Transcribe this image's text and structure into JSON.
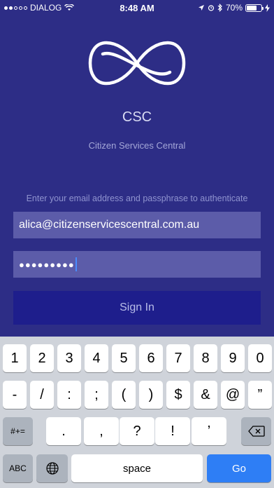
{
  "status_bar": {
    "carrier": "DIALOG",
    "time": "8:48 AM",
    "battery_percent": "70%",
    "battery_level": 0.7
  },
  "brand": {
    "name": "CSC",
    "subtitle": "Citizen Services Central"
  },
  "form": {
    "instructions": "Enter your email address and passphrase to authenticate",
    "email_value": "alica@citizenservicescentral.com.au",
    "password_mask": "●●●●●●●●●",
    "signin_label": "Sign In"
  },
  "keyboard": {
    "row1": [
      "1",
      "2",
      "3",
      "4",
      "5",
      "6",
      "7",
      "8",
      "9",
      "0"
    ],
    "row2": [
      "-",
      "/",
      ":",
      ";",
      "(",
      ")",
      "$",
      "&",
      "@",
      "”"
    ],
    "row3": [
      ".",
      ",",
      "?",
      "!",
      "’"
    ],
    "mode_key": "#+=",
    "abc_key": "ABC",
    "space_key": "space",
    "go_key": "Go"
  },
  "colors": {
    "background": "#2d2d86",
    "field": "#5c5ca9",
    "button": "#1e1e8c",
    "go": "#2e7ef5"
  }
}
